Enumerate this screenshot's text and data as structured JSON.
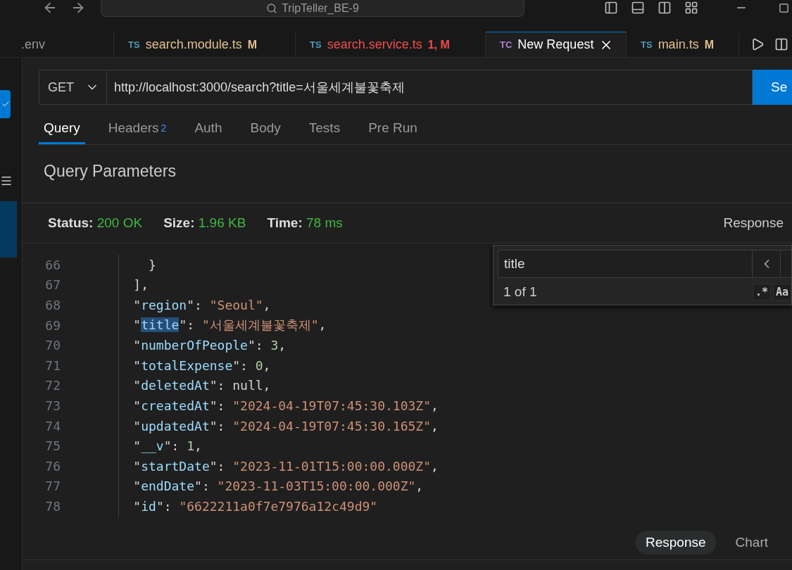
{
  "title_bar": {
    "search": "TripTeller_BE-9"
  },
  "editor_tabs": [
    {
      "name": ".env",
      "kind": "plain",
      "selected": false
    },
    {
      "icon": "TS",
      "name": "search.module.ts",
      "badge": "M",
      "kind": "modified",
      "selected": false
    },
    {
      "icon": "TS",
      "name": "search.service.ts",
      "badge": "1, M",
      "kind": "error",
      "selected": false
    },
    {
      "icon": "TC",
      "name": "New Request",
      "kind": "client",
      "selected": true
    },
    {
      "icon": "TS",
      "name": "main.ts",
      "badge": "M",
      "kind": "modified",
      "selected": false
    }
  ],
  "request": {
    "method": "GET",
    "url": "http://localhost:3000/search?title=서울세계불꽃축제",
    "send": "Se"
  },
  "request_tabs": [
    {
      "label": "Query",
      "selected": true
    },
    {
      "label": "Headers",
      "count": "2",
      "selected": false
    },
    {
      "label": "Auth",
      "selected": false
    },
    {
      "label": "Body",
      "selected": false
    },
    {
      "label": "Tests",
      "selected": false
    },
    {
      "label": "Pre Run",
      "selected": false
    }
  ],
  "section_title": "Query Parameters",
  "status": [
    {
      "label": "Status:",
      "value": "200 OK"
    },
    {
      "label": "Size:",
      "value": "1.96 KB"
    },
    {
      "label": "Time:",
      "value": "78 ms"
    }
  ],
  "response_label": "Response",
  "code_lines": [
    {
      "number": "66",
      "tokens": [
        {
          "kind": "punct",
          "text": "      }"
        }
      ]
    },
    {
      "number": "67",
      "tokens": [
        {
          "kind": "punct",
          "text": "    ],"
        }
      ]
    },
    {
      "number": "68",
      "tokens": [
        {
          "kind": "punct",
          "text": "    \""
        },
        {
          "kind": "key",
          "text": "region"
        },
        {
          "kind": "punct",
          "text": "\": "
        },
        {
          "kind": "str",
          "text": "\"Seoul\""
        },
        {
          "kind": "punct",
          "text": ","
        }
      ]
    },
    {
      "number": "69",
      "tokens": [
        {
          "kind": "punct",
          "text": "    \""
        },
        {
          "kind": "key",
          "text": "title",
          "match": true
        },
        {
          "kind": "punct",
          "text": "\": "
        },
        {
          "kind": "str",
          "text": "\"서울세계불꽃축제\""
        },
        {
          "kind": "punct",
          "text": ","
        }
      ]
    },
    {
      "number": "70",
      "tokens": [
        {
          "kind": "punct",
          "text": "    \""
        },
        {
          "kind": "key",
          "text": "numberOfPeople"
        },
        {
          "kind": "punct",
          "text": "\": "
        },
        {
          "kind": "num",
          "text": "3"
        },
        {
          "kind": "punct",
          "text": ","
        }
      ]
    },
    {
      "number": "71",
      "tokens": [
        {
          "kind": "punct",
          "text": "    \""
        },
        {
          "kind": "key",
          "text": "totalExpense"
        },
        {
          "kind": "punct",
          "text": "\": "
        },
        {
          "kind": "num",
          "text": "0"
        },
        {
          "kind": "punct",
          "text": ","
        }
      ]
    },
    {
      "number": "72",
      "tokens": [
        {
          "kind": "punct",
          "text": "    \""
        },
        {
          "kind": "key",
          "text": "deletedAt"
        },
        {
          "kind": "punct",
          "text": "\": null,"
        }
      ]
    },
    {
      "number": "73",
      "tokens": [
        {
          "kind": "punct",
          "text": "    \""
        },
        {
          "kind": "key",
          "text": "createdAt"
        },
        {
          "kind": "punct",
          "text": "\": "
        },
        {
          "kind": "str",
          "text": "\"2024-04-19T07:45:30.103Z\""
        },
        {
          "kind": "punct",
          "text": ","
        }
      ]
    },
    {
      "number": "74",
      "tokens": [
        {
          "kind": "punct",
          "text": "    \""
        },
        {
          "kind": "key",
          "text": "updatedAt"
        },
        {
          "kind": "punct",
          "text": "\": "
        },
        {
          "kind": "str",
          "text": "\"2024-04-19T07:45:30.165Z\""
        },
        {
          "kind": "punct",
          "text": ","
        }
      ]
    },
    {
      "number": "75",
      "tokens": [
        {
          "kind": "punct",
          "text": "    \""
        },
        {
          "kind": "key",
          "text": "__v"
        },
        {
          "kind": "punct",
          "text": "\": "
        },
        {
          "kind": "num",
          "text": "1"
        },
        {
          "kind": "punct",
          "text": ","
        }
      ]
    },
    {
      "number": "76",
      "tokens": [
        {
          "kind": "punct",
          "text": "    \""
        },
        {
          "kind": "key",
          "text": "startDate"
        },
        {
          "kind": "punct",
          "text": "\": "
        },
        {
          "kind": "str",
          "text": "\"2023-11-01T15:00:00.000Z\""
        },
        {
          "kind": "punct",
          "text": ","
        }
      ]
    },
    {
      "number": "77",
      "tokens": [
        {
          "kind": "punct",
          "text": "    \""
        },
        {
          "kind": "key",
          "text": "endDate"
        },
        {
          "kind": "punct",
          "text": "\": "
        },
        {
          "kind": "str",
          "text": "\"2023-11-03T15:00:00.000Z\""
        },
        {
          "kind": "punct",
          "text": ","
        }
      ]
    },
    {
      "number": "78",
      "tokens": [
        {
          "kind": "punct",
          "text": "    \""
        },
        {
          "kind": "key",
          "text": "id"
        },
        {
          "kind": "punct",
          "text": "\": "
        },
        {
          "kind": "str",
          "text": "\"6622211a0f7e7976a12c49d9\""
        }
      ]
    }
  ],
  "find": {
    "value": "title",
    "result": "1 of 1",
    "regex": ".*",
    "case": "Aa"
  },
  "view_tabs": [
    {
      "label": "Response",
      "selected": true
    },
    {
      "label": "Chart",
      "selected": false
    }
  ]
}
